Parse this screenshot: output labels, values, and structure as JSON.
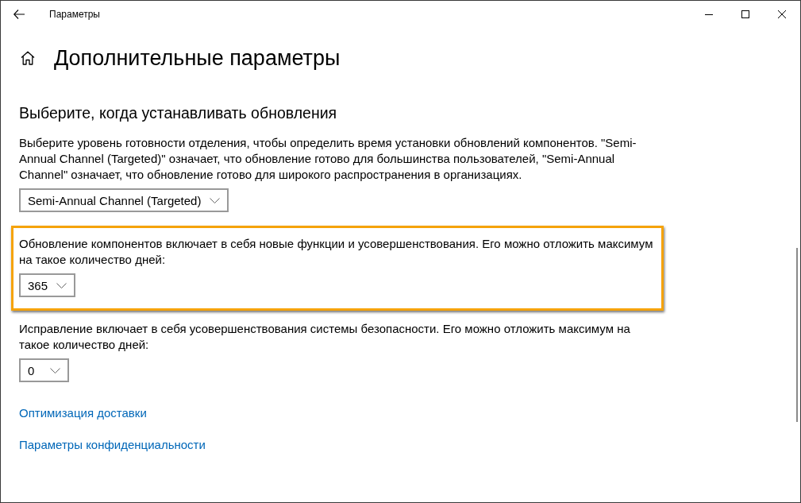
{
  "window": {
    "title": "Параметры"
  },
  "page": {
    "title": "Дополнительные параметры"
  },
  "section": {
    "heading": "Выберите, когда устанавливать обновления"
  },
  "settings": [
    {
      "description": "Выберите уровень готовности отделения, чтобы определить время установки обновлений компонентов. \"Semi-Annual Channel (Targeted)\" означает, что обновление готово для большинства пользователей, \"Semi-Annual Channel\" означает, что обновление готово для широкого распространения в организациях.",
      "dropdown": {
        "value": "Semi-Annual Channel (Targeted)"
      },
      "highlighted": false
    },
    {
      "description": "Обновление компонентов включает в себя новые функции и усовершенствования. Его можно отложить максимум на такое количество дней:",
      "dropdown": {
        "value": "365"
      },
      "highlighted": true
    },
    {
      "description": "Исправление включает в себя усовершенствования системы безопасности. Его можно отложить максимум на такое количество дней:",
      "dropdown": {
        "value": "0"
      },
      "highlighted": false
    }
  ],
  "links": [
    "Оптимизация доставки",
    "Параметры конфиденциальности"
  ]
}
